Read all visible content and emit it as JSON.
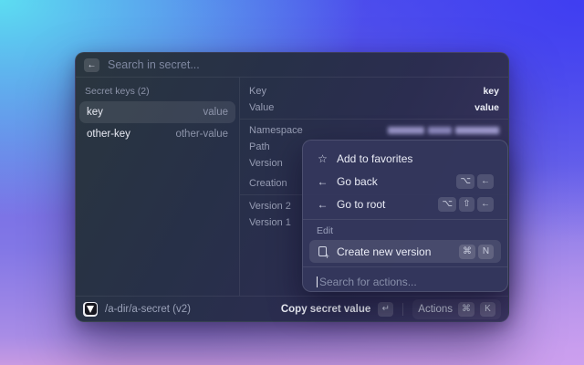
{
  "header": {
    "back_icon": "←",
    "search_placeholder": "Search in secret..."
  },
  "secret_list": {
    "title": "Secret keys (2)",
    "items": [
      {
        "name": "key",
        "value": "value",
        "selected": true
      },
      {
        "name": "other-key",
        "value": "other-value",
        "selected": false
      }
    ]
  },
  "details": {
    "rows": [
      {
        "label": "Key",
        "value": "key"
      },
      {
        "label": "Value",
        "value": "value"
      },
      {
        "label": "Namespace",
        "value": "",
        "redacted": true
      },
      {
        "label": "Path",
        "value": ""
      },
      {
        "label": "Version",
        "value": ""
      },
      {
        "label": "Creation",
        "value": ""
      },
      {
        "label": "Version 2",
        "value": ""
      },
      {
        "label": "Version 1",
        "value": ""
      }
    ]
  },
  "action_menu": {
    "items": [
      {
        "icon": "☆",
        "label": "Add to favorites"
      },
      {
        "icon": "←",
        "label": "Go back",
        "keys": [
          "⌥",
          "←"
        ]
      },
      {
        "icon": "←",
        "label": "Go to root",
        "keys": [
          "⌥",
          "⇧",
          "←"
        ]
      }
    ],
    "section": "Edit",
    "selected_item": {
      "label": "Create new version",
      "keys": [
        "⌘",
        "N"
      ]
    },
    "search_placeholder": "Search for actions..."
  },
  "status_bar": {
    "path": "/a-dir/a-secret (v2)",
    "primary_action": {
      "label": "Copy secret value",
      "key": "↵"
    },
    "secondary_action": {
      "label": "Actions",
      "keys": [
        "⌘",
        "K"
      ]
    }
  },
  "colors": {
    "bg_cyan": "#5ce4f2",
    "bg_blue": "#3e3cf2",
    "bg_purple": "#8277e6",
    "bg_pink": "#c79ae2",
    "window_dark": "#2b2d50",
    "popup_bg": "#34375c"
  }
}
